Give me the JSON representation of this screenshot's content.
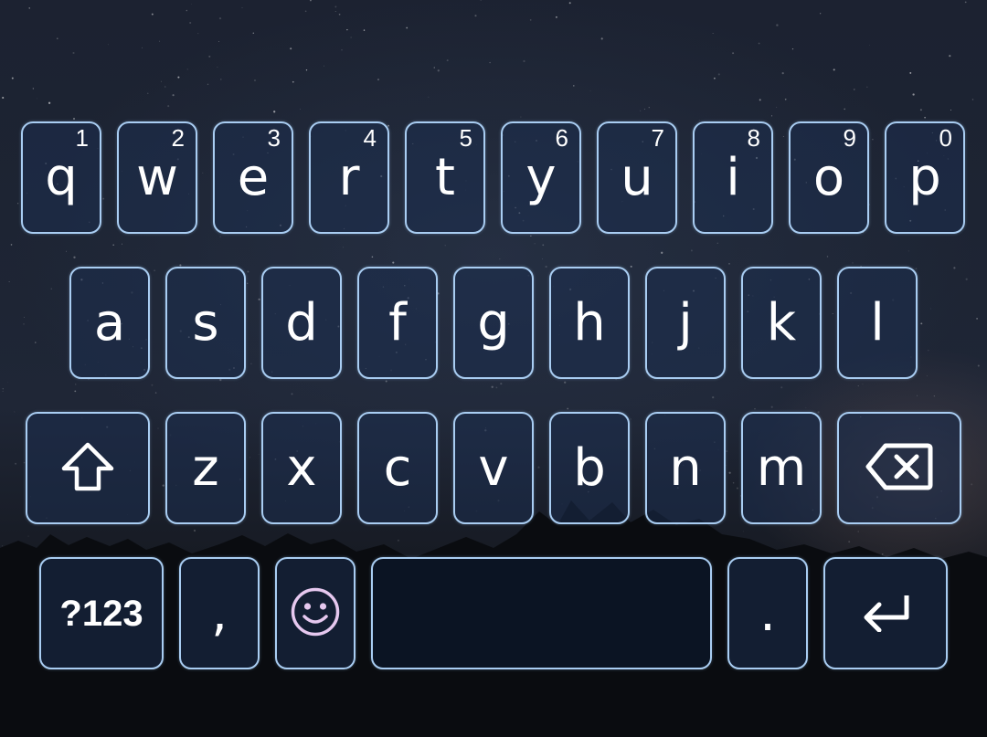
{
  "keyboard": {
    "rows": [
      [
        {
          "label": "q",
          "hint": "1"
        },
        {
          "label": "w",
          "hint": "2"
        },
        {
          "label": "e",
          "hint": "3"
        },
        {
          "label": "r",
          "hint": "4"
        },
        {
          "label": "t",
          "hint": "5"
        },
        {
          "label": "y",
          "hint": "6"
        },
        {
          "label": "u",
          "hint": "7"
        },
        {
          "label": "i",
          "hint": "8"
        },
        {
          "label": "o",
          "hint": "9"
        },
        {
          "label": "p",
          "hint": "0"
        }
      ],
      [
        {
          "label": "a"
        },
        {
          "label": "s"
        },
        {
          "label": "d"
        },
        {
          "label": "f"
        },
        {
          "label": "g"
        },
        {
          "label": "h"
        },
        {
          "label": "j"
        },
        {
          "label": "k"
        },
        {
          "label": "l"
        }
      ],
      [
        {
          "label": "z"
        },
        {
          "label": "x"
        },
        {
          "label": "c"
        },
        {
          "label": "v"
        },
        {
          "label": "b"
        },
        {
          "label": "n"
        },
        {
          "label": "m"
        }
      ]
    ],
    "bottom": {
      "symbols": "?123",
      "comma": ",",
      "period": "."
    },
    "icons": {
      "shift": "shift-arrow-up-icon",
      "backspace": "backspace-icon",
      "emoji": "smiley-face-icon",
      "enter": "enter-arrow-icon"
    },
    "colors": {
      "key_border": "#a9cdf2",
      "key_text": "#ffffff",
      "emoji_icon": "#e6c8ef"
    }
  }
}
